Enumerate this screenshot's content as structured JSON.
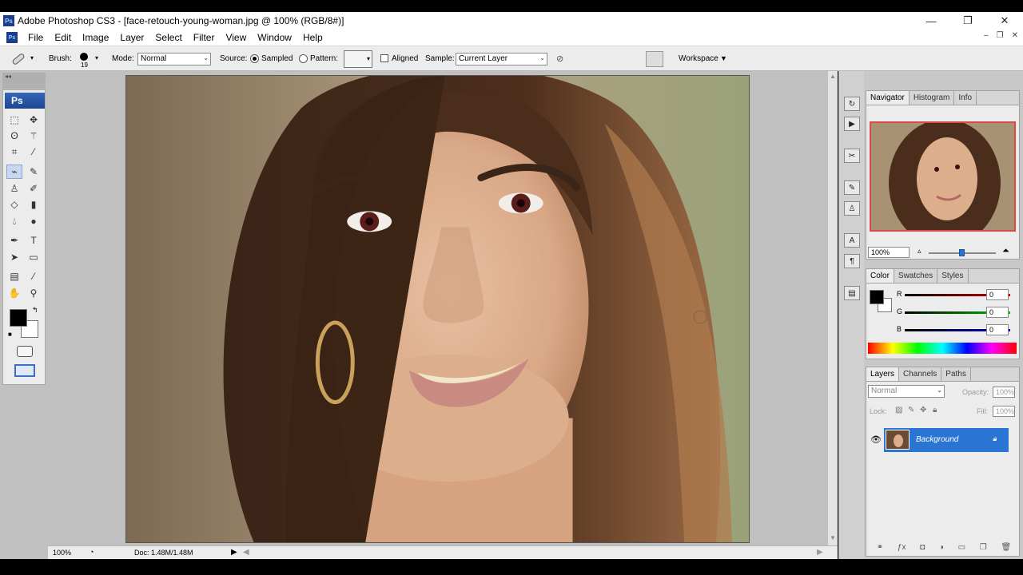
{
  "window": {
    "title": "Adobe Photoshop CS3 - [face-retouch-young-woman.jpg @ 100% (RGB/8#)]",
    "app_icon": "Ps",
    "controls": [
      "—",
      "❐",
      "✕"
    ]
  },
  "menu": {
    "items": [
      "File",
      "Edit",
      "Image",
      "Layer",
      "Select",
      "Filter",
      "View",
      "Window",
      "Help"
    ],
    "doc_controls": [
      "–",
      "❐",
      "✕"
    ]
  },
  "options": {
    "brush_label": "Brush:",
    "brush_size": "19",
    "mode_label": "Mode:",
    "mode_value": "Normal",
    "source_label": "Source:",
    "sampled_label": "Sampled",
    "pattern_label": "Pattern:",
    "aligned_label": "Aligned",
    "sample_label": "Sample:",
    "sample_value": "Current Layer",
    "workspace_label": "Workspace"
  },
  "toolbox": {
    "logo": "Ps"
  },
  "status": {
    "zoom": "100%",
    "doc": "Doc: 1.48M/1.48M"
  },
  "navigator": {
    "tabs": [
      "Navigator",
      "Histogram",
      "Info"
    ],
    "zoom": "100%",
    "zoom_level": 0.5
  },
  "color_panel": {
    "tabs": [
      "Color",
      "Swatches",
      "Styles"
    ],
    "channels": [
      {
        "label": "R",
        "value": "0",
        "color": "#d00000"
      },
      {
        "label": "G",
        "value": "0",
        "color": "#00a000"
      },
      {
        "label": "B",
        "value": "0",
        "color": "#0000d0"
      }
    ],
    "foreground": "#000000"
  },
  "layers_panel": {
    "tabs": [
      "Layers",
      "Channels",
      "Paths"
    ],
    "blend_mode": "Normal",
    "opacity_label": "Opacity:",
    "opacity": "100%",
    "lock_label": "Lock:",
    "fill_label": "Fill:",
    "fill": "100%",
    "layer_name": "Background"
  },
  "colors": {
    "accent": "#2a75d4",
    "workspace": "#c0c0c0"
  }
}
